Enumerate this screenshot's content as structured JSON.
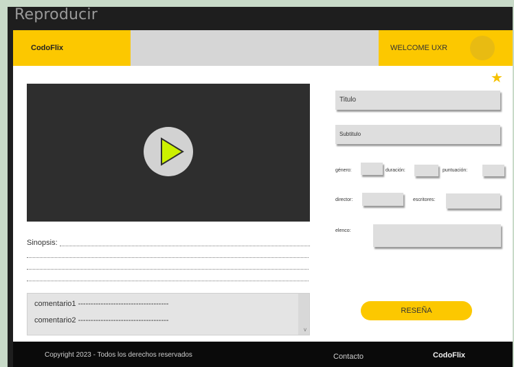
{
  "window": {
    "title": "Reproducir"
  },
  "header": {
    "brand": "CodoFlix",
    "welcome": "WELCOME UXR"
  },
  "player": {
    "play_icon": "play-icon"
  },
  "synopsis": {
    "label": "Sinopsis:"
  },
  "comments": {
    "items": [
      "comentario1 ------------------------------------",
      "comentario2 ------------------------------------"
    ]
  },
  "details": {
    "title_placeholder": "Titulo",
    "subtitle_placeholder": "Subtitulo",
    "genre_label": "género:",
    "duration_label": "duración:",
    "rating_label": "puntuación:",
    "director_label": "director:",
    "writers_label": "escritores:",
    "cast_label": "elenco:"
  },
  "review_button": "RESEÑA",
  "favorite_icon": "star-icon",
  "footer": {
    "copyright": "Copyright 2023 - Todos los derechos reservados",
    "contact": "Contacto",
    "brand": "CodoFlix"
  },
  "colors": {
    "accent": "#fcc800",
    "play": "#ccf000",
    "dark": "#1e1e1e"
  }
}
